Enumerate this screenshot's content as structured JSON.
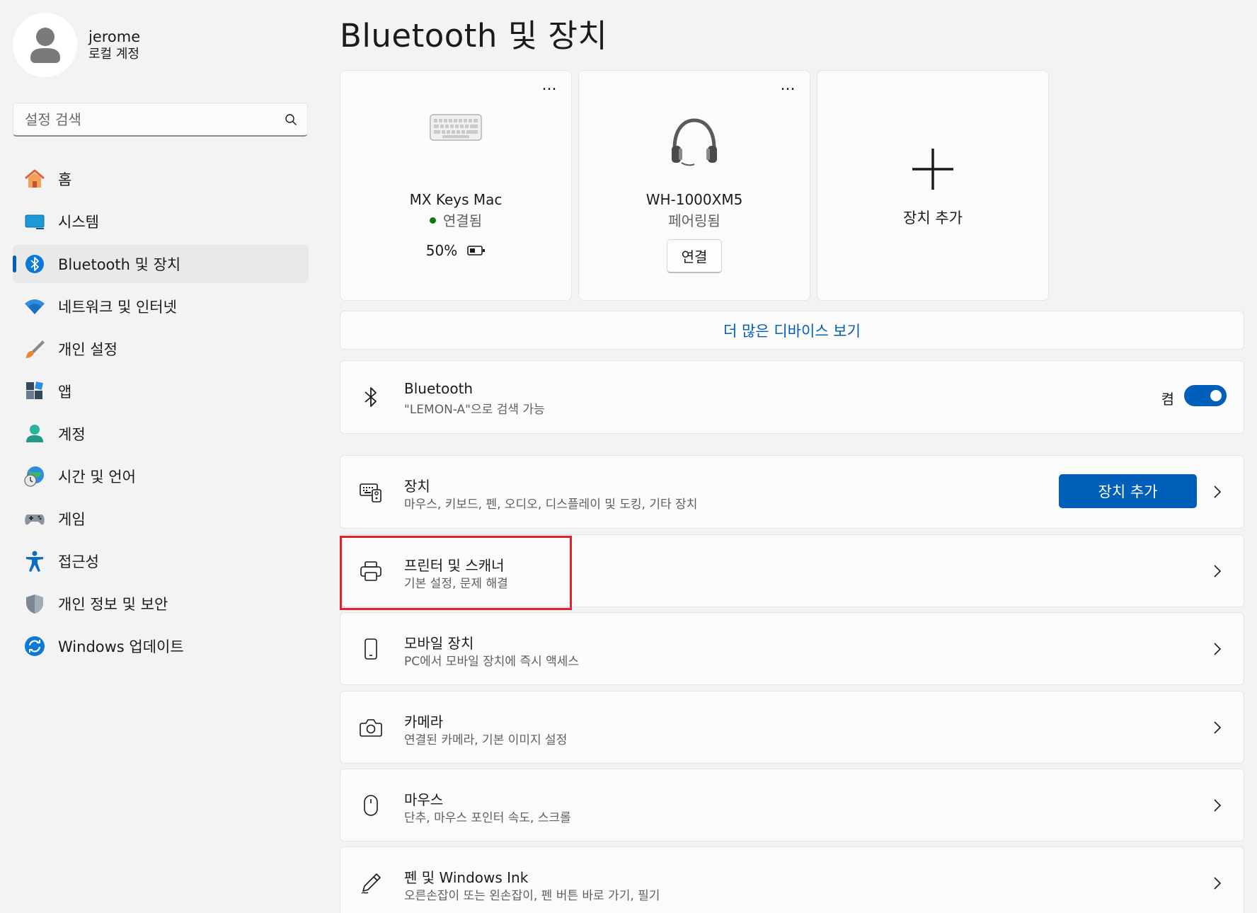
{
  "profile": {
    "name": "jerome",
    "account_type": "로컬 계정"
  },
  "search": {
    "placeholder": "설정 검색"
  },
  "nav": {
    "items": [
      {
        "label": "홈",
        "icon": "home-icon"
      },
      {
        "label": "시스템",
        "icon": "system-icon"
      },
      {
        "label": "Bluetooth 및 장치",
        "icon": "bluetooth-icon",
        "active": true
      },
      {
        "label": "네트워크 및 인터넷",
        "icon": "wifi-icon"
      },
      {
        "label": "개인 설정",
        "icon": "brush-icon"
      },
      {
        "label": "앱",
        "icon": "apps-icon"
      },
      {
        "label": "계정",
        "icon": "account-icon"
      },
      {
        "label": "시간 및 언어",
        "icon": "globe-clock-icon"
      },
      {
        "label": "게임",
        "icon": "gamepad-icon"
      },
      {
        "label": "접근성",
        "icon": "accessibility-icon"
      },
      {
        "label": "개인 정보 및 보안",
        "icon": "shield-icon"
      },
      {
        "label": "Windows 업데이트",
        "icon": "update-icon"
      }
    ]
  },
  "page": {
    "title": "Bluetooth 및 장치"
  },
  "device_cards": [
    {
      "name": "MX Keys Mac",
      "status": "연결됨",
      "battery": "50%",
      "more": "..."
    },
    {
      "name": "WH-1000XM5",
      "status": "페어링됨",
      "button": "연결",
      "more": "..."
    },
    {
      "label": "장치 추가"
    }
  ],
  "more_devices": {
    "label": "더 많은 디바이스 보기"
  },
  "bluetooth_row": {
    "title": "Bluetooth",
    "subtitle": "\"LEMON-A\"으로 검색 가능",
    "toggle_label": "켬",
    "toggle_on": true
  },
  "rows": [
    {
      "title": "장치",
      "subtitle": "마우스, 키보드, 펜, 오디오, 디스플레이 및 도킹, 기타 장치",
      "button": "장치 추가"
    },
    {
      "title": "프린터 및 스캐너",
      "subtitle": "기본 설정, 문제 해결"
    },
    {
      "title": "모바일 장치",
      "subtitle": "PC에서 모바일 장치에 즉시 액세스"
    },
    {
      "title": "카메라",
      "subtitle": "연결된 카메라, 기본 이미지 설정"
    },
    {
      "title": "마우스",
      "subtitle": "단추, 마우스 포인터 속도, 스크롤"
    },
    {
      "title": "펜 및 Windows Ink",
      "subtitle": "오른손잡이 또는 왼손잡이, 펜 버튼 바로 가기, 필기"
    }
  ],
  "colors": {
    "accent": "#005fb8",
    "connected": "#0f7b0f",
    "highlight": "#e0232d"
  }
}
